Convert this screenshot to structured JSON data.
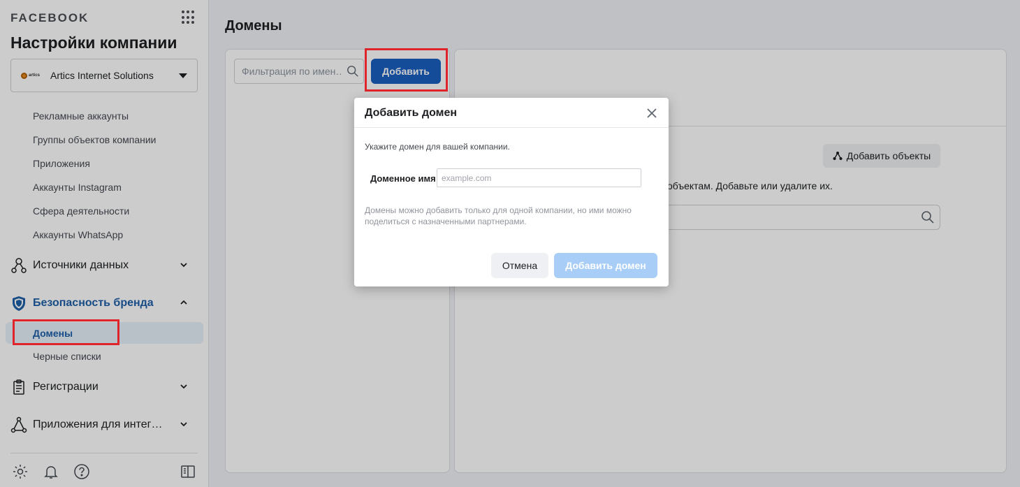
{
  "sidebar": {
    "brand": "FACEBOOK",
    "company_title": "Настройки компании",
    "company_name": "Artics Internet Solutions",
    "company_logo_text": "artics",
    "sub_items": [
      "Рекламные аккаунты",
      "Группы объектов компании",
      "Приложения",
      "Аккаунты Instagram",
      "Сфера деятельности",
      "Аккаунты WhatsApp"
    ],
    "sections": {
      "data_sources": "Источники данных",
      "brand_safety": "Безопасность бренда",
      "registrations": "Регистрации",
      "integration_apps": "Приложения для интег…"
    },
    "brand_safety_items": {
      "domains": "Домены",
      "blacklists": "Черные списки"
    }
  },
  "main": {
    "title": "Домены",
    "filter_placeholder": "Фильтрация по имен…",
    "add_button": "Добавить",
    "add_objects_button": "Добавить объекты",
    "right_text": "объектам. Добавьте или удалите их."
  },
  "modal": {
    "title": "Добавить домен",
    "description": "Укажите домен для вашей компании.",
    "field_label": "Доменное имя",
    "field_placeholder": "example.com",
    "note": "Домены можно добавить только для одной компании, но ими можно поделиться с назначенными партнерами.",
    "cancel": "Отмена",
    "confirm": "Добавить домен"
  },
  "colors": {
    "accent": "#1b5fc1",
    "active_text": "#1d5fa8",
    "highlight": "#e0242c",
    "disabled_button": "#a8cdf7"
  }
}
